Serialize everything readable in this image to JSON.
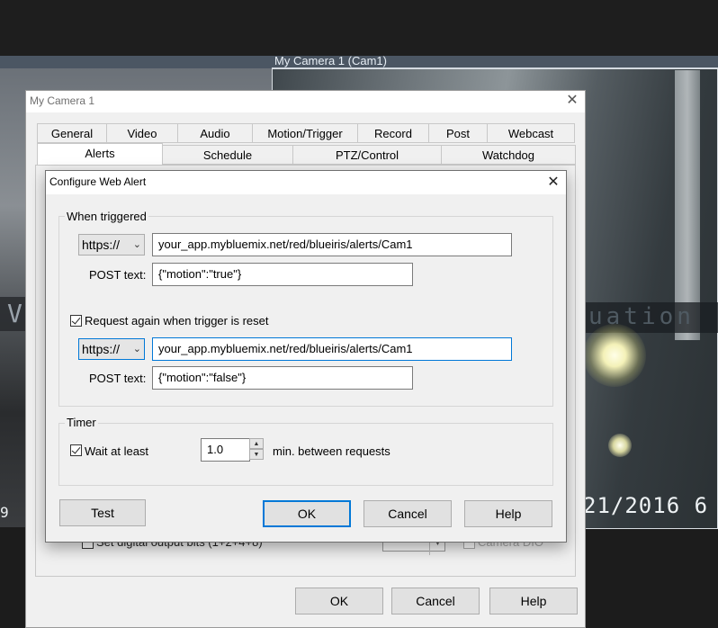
{
  "background": {
    "camera_title": "My Camera 1 (Cam1)",
    "camera_overlay_text": "uation",
    "camera_timestamp": "21/2016 6",
    "left_overlay_text": "V",
    "left_stamp": "9"
  },
  "camera_window": {
    "title": "My Camera 1",
    "tabs_row1": [
      "General",
      "Video",
      "Audio",
      "Motion/Trigger",
      "Record",
      "Post",
      "Webcast"
    ],
    "tabs_row2": [
      "Alerts",
      "Schedule",
      "PTZ/Control",
      "Watchdog"
    ],
    "active_tab": "Alerts",
    "behind_checkbox_label": "Set digital output bits (1+2+4+8)",
    "behind_checkbox2_label": "Camera DIO",
    "ok_label": "OK",
    "cancel_label": "Cancel",
    "help_label": "Help"
  },
  "dialog": {
    "title": "Configure Web Alert",
    "when_triggered": {
      "group_label": "When triggered",
      "scheme": "https://",
      "url": "your_app.mybluemix.net/red/blueiris/alerts/Cam1",
      "post_label": "POST text:",
      "post_text": "{\"motion\":\"true\"}"
    },
    "request_again": {
      "checked": true,
      "label": "Request again when trigger is reset",
      "scheme": "https://",
      "url": "your_app.mybluemix.net/red/blueiris/alerts/Cam1",
      "post_label": "POST text:",
      "post_text": "{\"motion\":\"false\"}"
    },
    "timer": {
      "group_label": "Timer",
      "wait_checked": true,
      "wait_label": "Wait at least",
      "value": "1.0",
      "suffix": "min. between requests"
    },
    "buttons": {
      "test": "Test",
      "ok": "OK",
      "cancel": "Cancel",
      "help": "Help"
    }
  }
}
